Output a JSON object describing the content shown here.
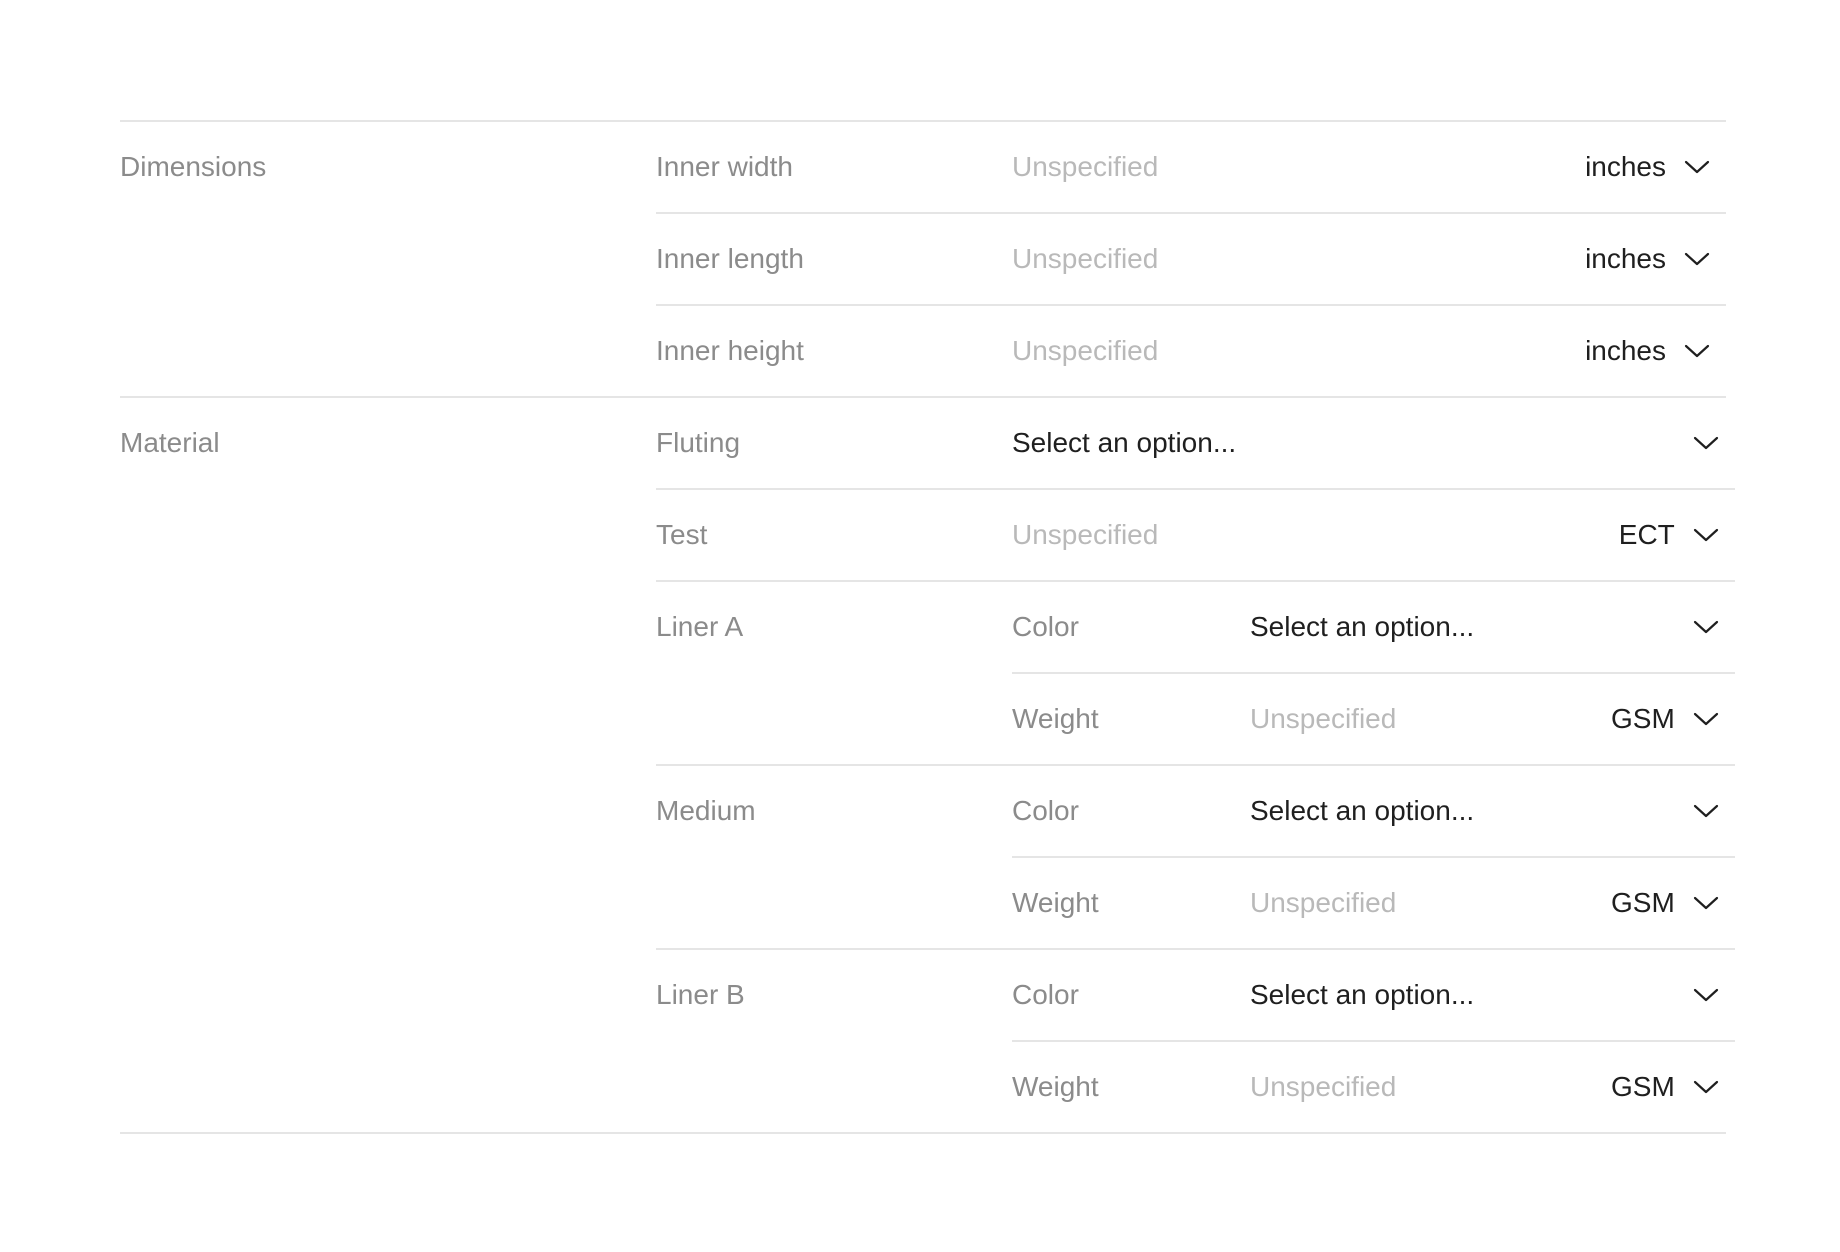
{
  "sections": {
    "dimensions": {
      "label": "Dimensions",
      "inner_width": {
        "label": "Inner width",
        "placeholder": "Unspecified",
        "unit": "inches"
      },
      "inner_length": {
        "label": "Inner length",
        "placeholder": "Unspecified",
        "unit": "inches"
      },
      "inner_height": {
        "label": "Inner height",
        "placeholder": "Unspecified",
        "unit": "inches"
      }
    },
    "material": {
      "label": "Material",
      "fluting": {
        "label": "Fluting",
        "value": "Select an option..."
      },
      "test": {
        "label": "Test",
        "placeholder": "Unspecified",
        "unit": "ECT"
      },
      "liner_a": {
        "label": "Liner A",
        "color": {
          "label": "Color",
          "value": "Select an option..."
        },
        "weight": {
          "label": "Weight",
          "placeholder": "Unspecified",
          "unit": "GSM"
        }
      },
      "medium": {
        "label": "Medium",
        "color": {
          "label": "Color",
          "value": "Select an option..."
        },
        "weight": {
          "label": "Weight",
          "placeholder": "Unspecified",
          "unit": "GSM"
        }
      },
      "liner_b": {
        "label": "Liner B",
        "color": {
          "label": "Color",
          "value": "Select an option..."
        },
        "weight": {
          "label": "Weight",
          "placeholder": "Unspecified",
          "unit": "GSM"
        }
      }
    }
  },
  "icons": {
    "dropdown": "chevron-down-icon"
  },
  "colors": {
    "label": "#8b8b8b",
    "placeholder": "#b9b9b9",
    "text": "#1f1f1f",
    "divider": "#e5e5e5"
  }
}
